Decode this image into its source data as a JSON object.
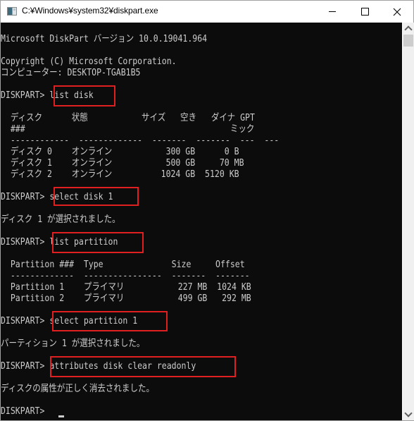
{
  "window": {
    "title": "C:¥Windows¥system32¥diskpart.exe",
    "app_icon": "console-window-icon",
    "controls": {
      "minimize": "minimize-icon",
      "maximize": "maximize-icon",
      "close": "close-icon"
    }
  },
  "console": {
    "colors": {
      "background": "#0c0c0c",
      "text": "#cccccc",
      "highlight_box": "#e02020"
    },
    "lines": [
      {
        "text": "Microsoft DiskPart バージョン 10.0.19041.964"
      },
      {
        "text": ""
      },
      {
        "text": "Copyright (C) Microsoft Corporation."
      },
      {
        "text": "コンピューター: DESKTOP-TGAB1B5"
      },
      {
        "text": ""
      },
      {
        "text": "DISKPART> list disk"
      },
      {
        "text": ""
      },
      {
        "text": "  ディスク      状態           サイズ   空き   ダイナ GPT"
      },
      {
        "text": "  ###                                          ミック"
      },
      {
        "text": "  ------------  -------------  -------  -------  ---  ---"
      },
      {
        "text": "  ディスク 0    オンライン           300 GB      0 B"
      },
      {
        "text": "  ディスク 1    オンライン           500 GB     70 MB"
      },
      {
        "text": "  ディスク 2    オンライン          1024 GB  5120 KB"
      },
      {
        "text": ""
      },
      {
        "text": "DISKPART> select disk 1"
      },
      {
        "text": ""
      },
      {
        "text": "ディスク 1 が選択されました。"
      },
      {
        "text": ""
      },
      {
        "text": "DISKPART> list partition"
      },
      {
        "text": ""
      },
      {
        "text": "  Partition ###  Type              Size     Offset"
      },
      {
        "text": "  -------------  ----------------  -------  -------"
      },
      {
        "text": "  Partition 1    プライマリ           227 MB  1024 KB"
      },
      {
        "text": "  Partition 2    プライマリ           499 GB   292 MB"
      },
      {
        "text": ""
      },
      {
        "text": "DISKPART> select partition 1"
      },
      {
        "text": ""
      },
      {
        "text": "パーティション 1 が選択されました。"
      },
      {
        "text": ""
      },
      {
        "text": "DISKPART> attributes disk clear readonly"
      },
      {
        "text": ""
      },
      {
        "text": "ディスクの属性が正しく消去されました。"
      },
      {
        "text": ""
      },
      {
        "text": "DISKPART> "
      }
    ],
    "highlighted_commands": [
      "list disk",
      "select disk 1",
      "list partition",
      "select partition 1",
      "attributes disk clear readonly"
    ],
    "prompt": "DISKPART>"
  },
  "list_disk_table": {
    "headers": [
      "ディスク ###",
      "状態",
      "サイズ",
      "空き",
      "ダイナミック",
      "GPT"
    ],
    "rows": [
      [
        "ディスク 0",
        "オンライン",
        "300 GB",
        "0 B",
        "",
        ""
      ],
      [
        "ディスク 1",
        "オンライン",
        "500 GB",
        "70 MB",
        "",
        ""
      ],
      [
        "ディスク 2",
        "オンライン",
        "1024 GB",
        "5120 KB",
        "",
        ""
      ]
    ]
  },
  "list_partition_table": {
    "headers": [
      "Partition ###",
      "Type",
      "Size",
      "Offset"
    ],
    "rows": [
      [
        "Partition 1",
        "プライマリ",
        "227 MB",
        "1024 KB"
      ],
      [
        "Partition 2",
        "プライマリ",
        "499 GB",
        "292 MB"
      ]
    ]
  },
  "scrollbar": {
    "up_icon": "chevron-up-icon",
    "down_icon": "chevron-down-icon",
    "position": 0
  }
}
